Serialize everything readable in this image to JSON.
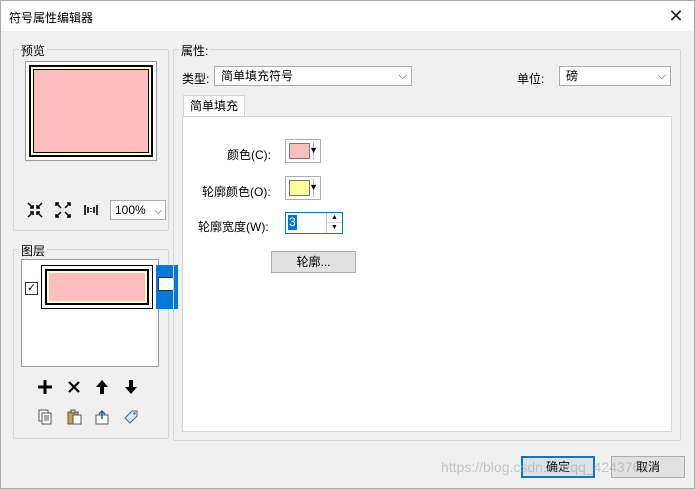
{
  "window": {
    "title": "符号属性编辑器"
  },
  "preview": {
    "group_label": "预览",
    "zoom_value": "100%"
  },
  "layers": {
    "group_label": "图层",
    "checked": true
  },
  "properties": {
    "group_label": "属性:",
    "type_label": "类型:",
    "type_value": "简单填充符号",
    "unit_label": "单位:",
    "unit_value": "磅",
    "tab_label": "简单填充",
    "color_label": "颜色(C):",
    "outline_color_label": "轮廓颜色(O):",
    "outline_width_label": "轮廓宽度(W):",
    "outline_width_value": "3",
    "outline_button": "轮廓..."
  },
  "footer": {
    "ok_label": "确定",
    "cancel_label": "取消"
  },
  "watermark": "https://blog.csdn.net/qq_42437697",
  "colors": {
    "fill": "#ffbebe",
    "outline": "#ffffbe",
    "selection": "#0078d7"
  },
  "icons": {
    "zoom_in": "collapse-arrows-icon",
    "zoom_out": "expand-arrows-icon",
    "actual_size": "actual-size-icon",
    "add": "plus-icon",
    "delete": "x-icon",
    "move_up": "arrow-up-icon",
    "move_down": "arrow-down-icon",
    "copy": "copy-icon",
    "paste": "paste-icon",
    "reset": "reset-icon",
    "tag": "tag-icon"
  }
}
